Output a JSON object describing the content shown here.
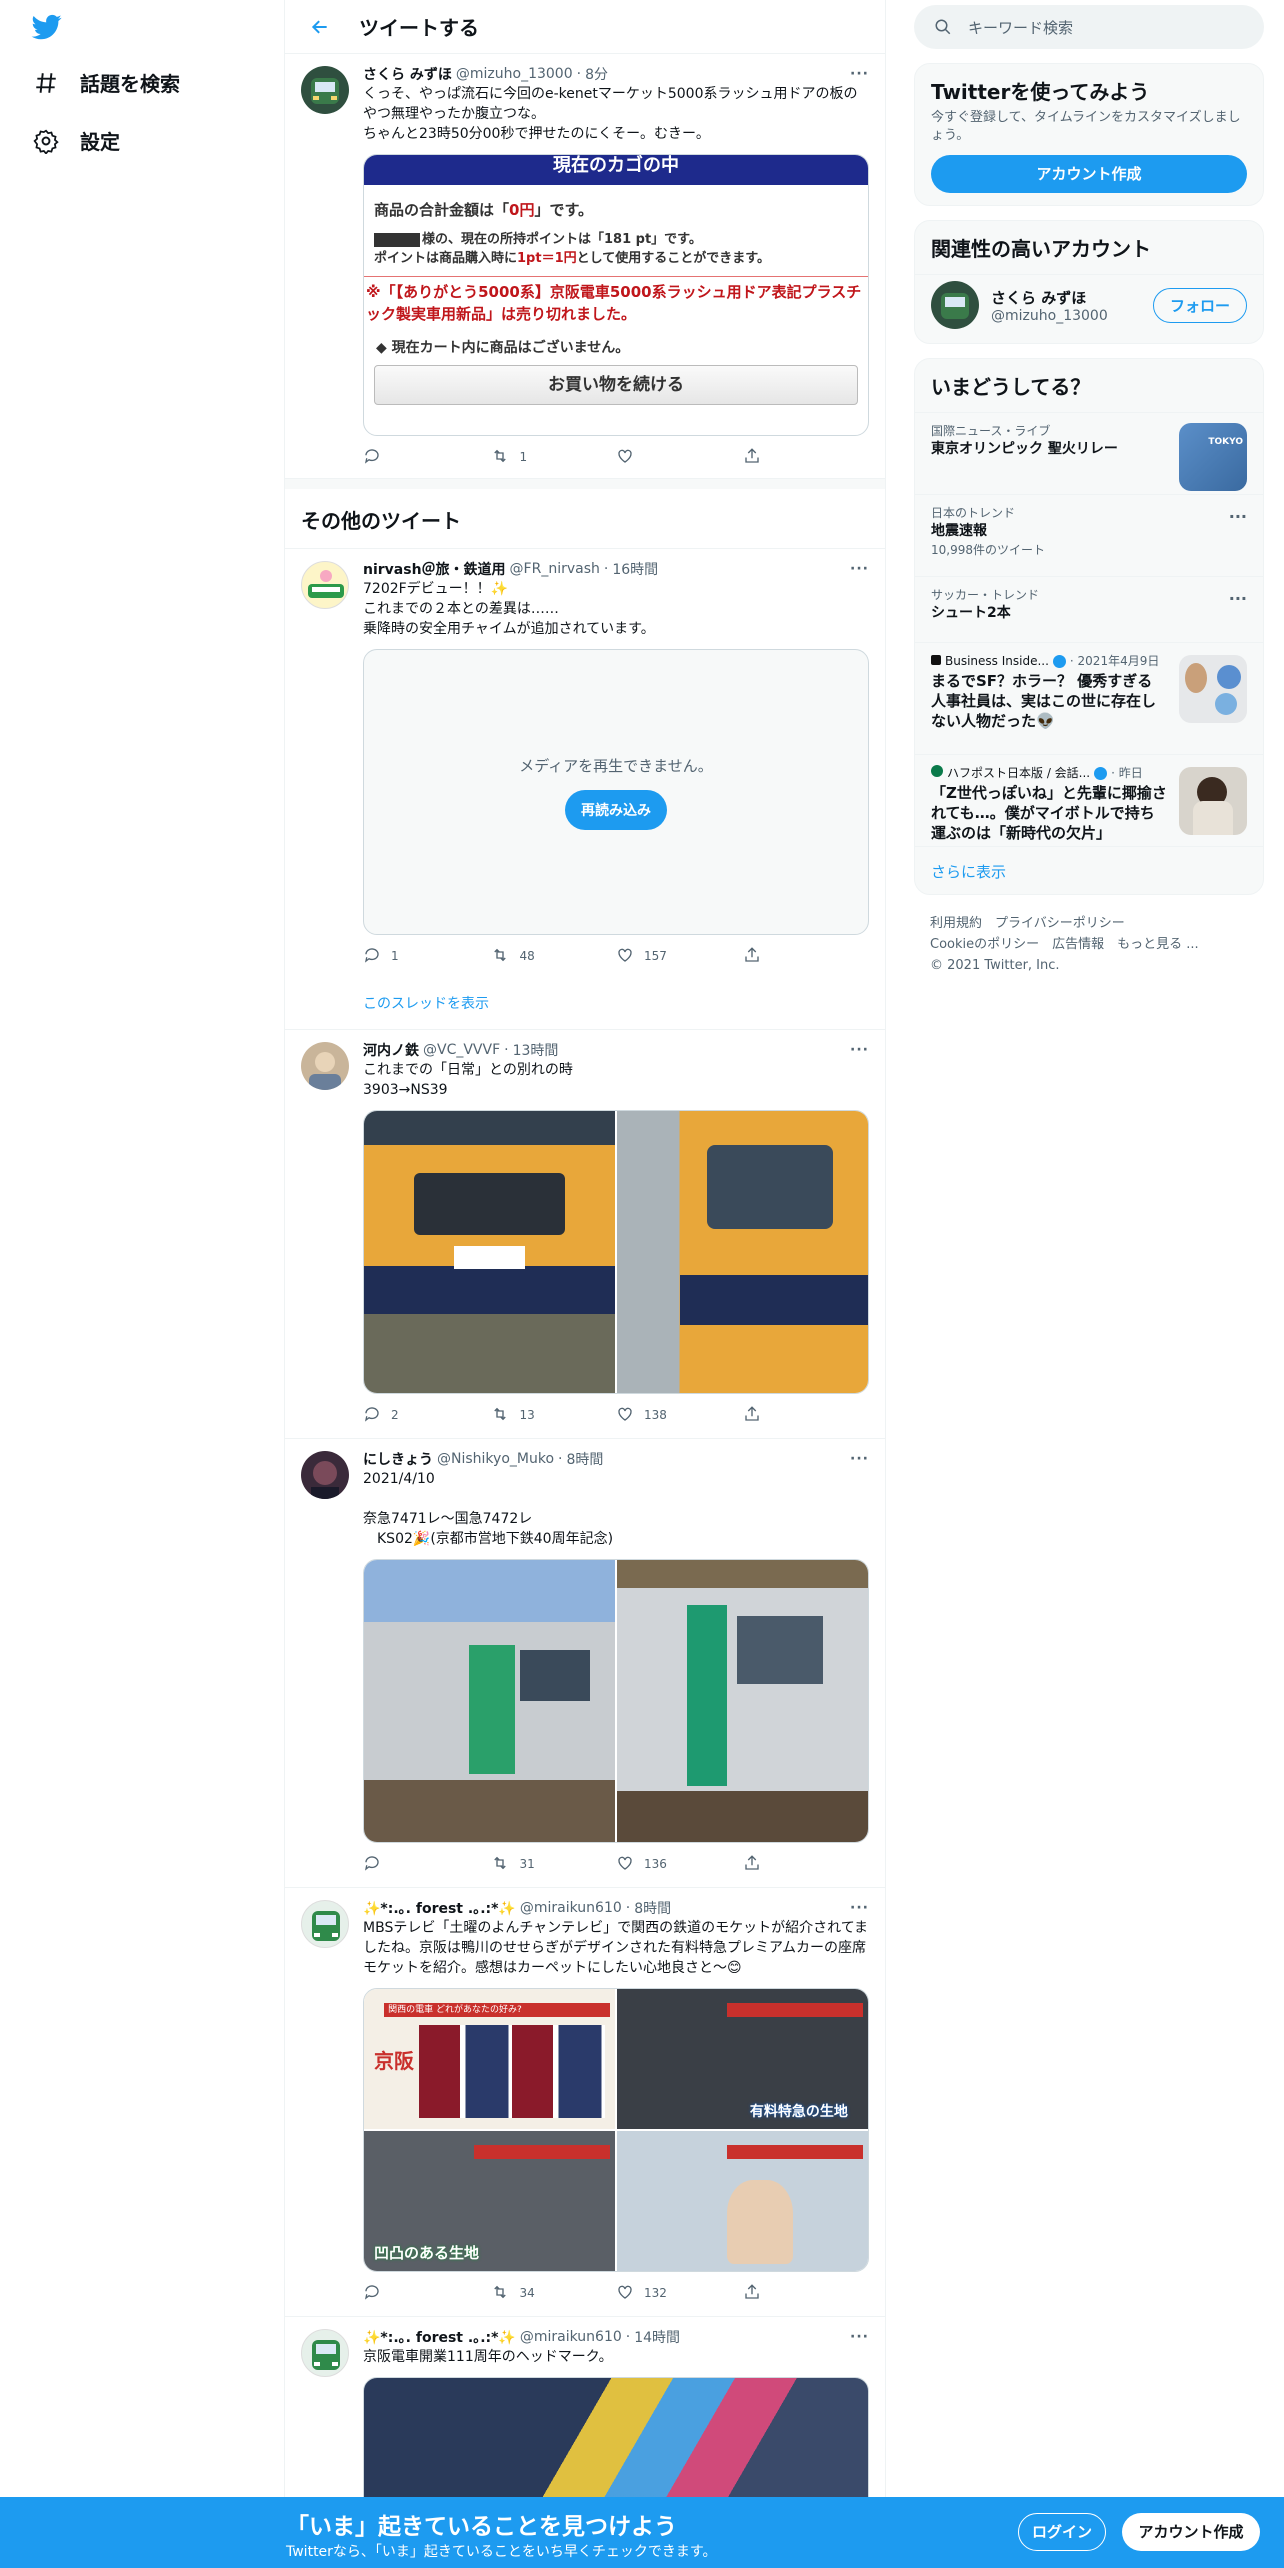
{
  "app": {
    "brand_color": "#1d9bf0"
  },
  "nav": {
    "explore": "話題を検索",
    "settings": "設定"
  },
  "header": {
    "title": "ツイートする"
  },
  "main_tweet": {
    "name": "さくら みずほ",
    "handle": "@mizuho_13000",
    "sep": "·",
    "time": "8分",
    "text": "くっそ、やっぱ流石に今回のe-kenetマーケット5000系ラッシュ用ドアの板のやつ無理やったか腹立つな。\nちゃんと23時50分00秒で押せたのにくそー。むきー。",
    "shot": {
      "banner": "現在のカゴの中",
      "line1a": "商品の合計金額は「",
      "line1b": "0円",
      "line1c": "」です。",
      "line2": "様の、現在の所持ポイントは「181 pt」です。",
      "line3a": "ポイントは商品購入時に",
      "line3b": "1pt＝1円",
      "line3c": "として使用することができます。",
      "sold": "※「【ありがとう5000系】京阪電車5000系ラッシュ用ドア表記プラスチック製実車用新品」は売り切れました。",
      "empty": "◆ 現在カート内に商品はございません。",
      "continue": "お買い物を続ける"
    },
    "stats": {
      "reply": "",
      "retweet": "1",
      "like": "",
      "share": ""
    }
  },
  "more_tweets_title": "その他のツイート",
  "tweets": [
    {
      "name": "nirvash＠旅・鉄道用",
      "handle": "@FR_nirvash",
      "sep": "·",
      "time": "16時間",
      "text": "7202Fデビュー！！✨\nこれまでの２本との差異は……\n乗降時の安全用チャイムが追加されています。",
      "media_error": "メディアを再生できません。",
      "reload": "再読み込み",
      "reply": "1",
      "retweet": "48",
      "like": "157",
      "thread": "このスレッドを表示"
    },
    {
      "name": "河内ノ鉄",
      "handle": "@VC_VVVF",
      "sep": "·",
      "time": "13時間",
      "text": "これまでの「日常」との別れの時\n3903→NS39",
      "reply": "2",
      "retweet": "13",
      "like": "138"
    },
    {
      "name": "にしきょう",
      "handle": "@Nishikyo_Muko",
      "sep": "·",
      "time": "8時間",
      "text": "2021/4/10\n\n奈急7471レ〜国急7472レ\n　KS02🎉(京都市営地下鉄40周年記念)",
      "reply": "",
      "retweet": "31",
      "like": "136"
    },
    {
      "name": "✨*:.｡. forest .｡.:*✨",
      "handle": "@miraikun610",
      "sep": "·",
      "time": "8時間",
      "text": "MBSテレビ「土曜のよんチャンテレビ」で関西の鉄道のモケットが紹介されてましたね。京阪は鴨川のせせらぎがデザインされた有料特急プレミアムカーの座席モケットを紹介。感想はカーペットにしたい心地良さと〜😊",
      "tv": {
        "header": "関西の電車 どれがあなたの好み?",
        "keihan": "京阪",
        "cap1": "有料特急の生地",
        "cap2": "凹凸のある生地"
      },
      "reply": "",
      "retweet": "34",
      "like": "132"
    },
    {
      "name": "✨*:.｡. forest .｡.:*✨",
      "handle": "@miraikun610",
      "sep": "·",
      "time": "14時間",
      "text": "京阪電車開業111周年のヘッドマーク。"
    }
  ],
  "right": {
    "search_placeholder": "キーワード検索",
    "signup": {
      "title": "Twitterを使ってみよう",
      "desc": "今すぐ登録して、タイムラインをカスタマイズしましょう。",
      "button": "アカウント作成"
    },
    "related": {
      "title": "関連性の高いアカウント",
      "name": "さくら みずほ",
      "handle": "@mizuho_13000",
      "follow": "フォロー"
    },
    "trends": {
      "title": "いまどうしてる？",
      "items": [
        {
          "meta": "国際ニュース・ライブ",
          "title": "東京オリンピック 聖火リレー",
          "sub": ""
        },
        {
          "meta": "日本のトレンド",
          "title": "地震速報",
          "sub": "10,998件のツイート"
        },
        {
          "meta": "サッカー・トレンド",
          "title": "シュート2本",
          "sub": ""
        },
        {
          "meta": "Business Inside...",
          "date": "· 2021年4月9日",
          "title": "まるでSF？ホラー？ 優秀すぎる人事社員は、実はこの世に存在しない人物だった👽",
          "sub": ""
        },
        {
          "meta": "ハフポスト日本版 / 会話...",
          "date": "· 昨日",
          "title": "「Z世代っぽいね」と先輩に揶揄されても…。僕がマイボトルで持ち運ぶのは「新時代の欠片」",
          "sub": ""
        }
      ],
      "more": "さらに表示",
      "tokyo": "TOKYO"
    },
    "footer": {
      "l1": "利用規約　プライバシーポリシー",
      "l2": "Cookieのポリシー　広告情報　もっと見る ...",
      "l3": "© 2021 Twitter, Inc."
    }
  },
  "banner": {
    "title": "「いま」起きていることを見つけよう",
    "sub": "Twitterなら、「いま」起きていることをいち早くチェックできます。",
    "login": "ログイン",
    "signup": "アカウント作成"
  }
}
